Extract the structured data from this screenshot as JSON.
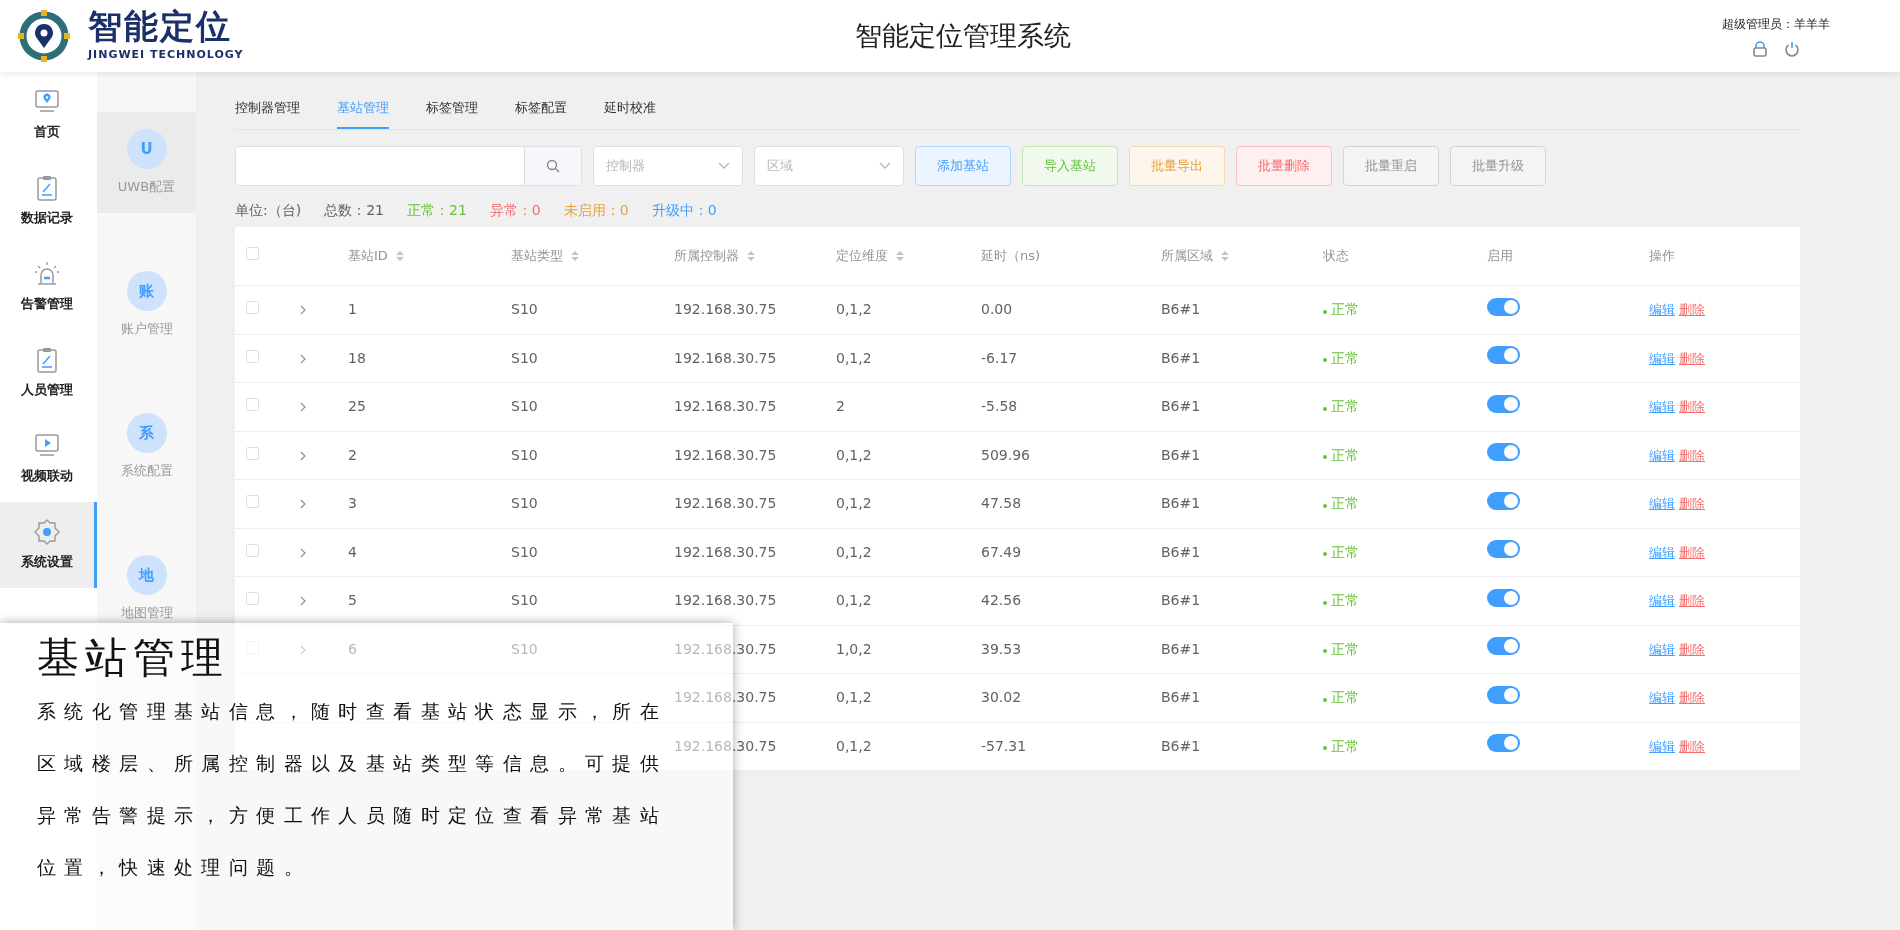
{
  "header": {
    "logo_title": "智能定位",
    "logo_subtitle": "JINGWEI TECHNOLOGY",
    "title": "智能定位管理系统",
    "user": "超级管理员：羊羊羊"
  },
  "sidebar": {
    "items": [
      {
        "label": "首页",
        "selected": false
      },
      {
        "label": "数据记录",
        "selected": false
      },
      {
        "label": "告警管理",
        "selected": false
      },
      {
        "label": "人员管理",
        "selected": false
      },
      {
        "label": "视频联动",
        "selected": false
      },
      {
        "label": "系统设置",
        "selected": true
      }
    ]
  },
  "subnav": {
    "items": [
      {
        "initial": "U",
        "label": "UWB配置",
        "selected": true
      },
      {
        "initial": "账",
        "label": "账户管理",
        "selected": false
      },
      {
        "initial": "系",
        "label": "系统配置",
        "selected": false
      },
      {
        "initial": "地",
        "label": "地图管理",
        "selected": false
      }
    ]
  },
  "tabs": [
    {
      "label": "控制器管理",
      "selected": false
    },
    {
      "label": "基站管理",
      "selected": true
    },
    {
      "label": "标签管理",
      "selected": false
    },
    {
      "label": "标签配置",
      "selected": false
    },
    {
      "label": "延时校准",
      "selected": false
    }
  ],
  "filters": {
    "selects": [
      {
        "placeholder": "控制器"
      },
      {
        "placeholder": "区域"
      }
    ]
  },
  "buttons": [
    {
      "label": "添加基站",
      "kind": "primary"
    },
    {
      "label": "导入基站",
      "kind": "success"
    },
    {
      "label": "批量导出",
      "kind": "warning"
    },
    {
      "label": "批量删除",
      "kind": "danger"
    },
    {
      "label": "批量重启",
      "kind": "default"
    },
    {
      "label": "批量升级",
      "kind": "default"
    }
  ],
  "stats": [
    {
      "text": "单位:（台)",
      "color": "#606266"
    },
    {
      "text": "总数：21",
      "color": "#606266"
    },
    {
      "text": "正常：21",
      "color": "#67c23a"
    },
    {
      "text": "异常：0",
      "color": "#f56c6c"
    },
    {
      "text": "未启用：0",
      "color": "#e6a23c"
    },
    {
      "text": "升级中：0",
      "color": "#409eff"
    }
  ],
  "table": {
    "all_checked": false,
    "columns": [
      {
        "label": "基站ID",
        "sortable": true
      },
      {
        "label": "基站类型",
        "sortable": true
      },
      {
        "label": "所属控制器",
        "sortable": true
      },
      {
        "label": "定位维度",
        "sortable": true
      },
      {
        "label": "延时（ns)",
        "sortable": false
      },
      {
        "label": "所属区域",
        "sortable": true
      },
      {
        "label": "状态",
        "sortable": false
      },
      {
        "label": "启用",
        "sortable": false
      },
      {
        "label": "操作",
        "sortable": false
      }
    ],
    "rows": [
      {
        "checked": false,
        "id": "1",
        "type": "S10",
        "controller": "192.168.30.75",
        "dimension": "0,1,2",
        "delay": "0.00",
        "area": "B6#1",
        "status": "正常",
        "enabled": true,
        "actions": [
          "编辑",
          "删除"
        ]
      },
      {
        "checked": false,
        "id": "18",
        "type": "S10",
        "controller": "192.168.30.75",
        "dimension": "0,1,2",
        "delay": "-6.17",
        "area": "B6#1",
        "status": "正常",
        "enabled": true,
        "actions": [
          "编辑",
          "删除"
        ]
      },
      {
        "checked": false,
        "id": "25",
        "type": "S10",
        "controller": "192.168.30.75",
        "dimension": "2",
        "delay": "-5.58",
        "area": "B6#1",
        "status": "正常",
        "enabled": true,
        "actions": [
          "编辑",
          "删除"
        ]
      },
      {
        "checked": false,
        "id": "2",
        "type": "S10",
        "controller": "192.168.30.75",
        "dimension": "0,1,2",
        "delay": "509.96",
        "area": "B6#1",
        "status": "正常",
        "enabled": true,
        "actions": [
          "编辑",
          "删除"
        ]
      },
      {
        "checked": false,
        "id": "3",
        "type": "S10",
        "controller": "192.168.30.75",
        "dimension": "0,1,2",
        "delay": "47.58",
        "area": "B6#1",
        "status": "正常",
        "enabled": true,
        "actions": [
          "编辑",
          "删除"
        ]
      },
      {
        "checked": false,
        "id": "4",
        "type": "S10",
        "controller": "192.168.30.75",
        "dimension": "0,1,2",
        "delay": "67.49",
        "area": "B6#1",
        "status": "正常",
        "enabled": true,
        "actions": [
          "编辑",
          "删除"
        ]
      },
      {
        "checked": false,
        "id": "5",
        "type": "S10",
        "controller": "192.168.30.75",
        "dimension": "0,1,2",
        "delay": "42.56",
        "area": "B6#1",
        "status": "正常",
        "enabled": true,
        "actions": [
          "编辑",
          "删除"
        ]
      },
      {
        "checked": false,
        "id": "6",
        "type": "S10",
        "controller": "192.168.30.75",
        "dimension": "1,0,2",
        "delay": "39.53",
        "area": "B6#1",
        "status": "正常",
        "enabled": true,
        "actions": [
          "编辑",
          "删除"
        ]
      },
      {
        "controller": "192.168.30.75",
        "dimension": "0,1,2",
        "delay": "30.02",
        "area": "B6#1",
        "status": "正常",
        "enabled": true,
        "actions": [
          "编辑",
          "删除"
        ]
      },
      {
        "controller": "192.168.30.75",
        "dimension": "0,1,2",
        "delay": "-57.31",
        "area": "B6#1",
        "status": "正常",
        "enabled": true,
        "actions": [
          "编辑",
          "删除"
        ]
      }
    ]
  },
  "overlay": {
    "title": "基站管理",
    "text": "系统化管理基站信息，随时查看基站状态显示，所在区域楼层、所属控制器以及基站类型等信息。可提供异常告警提示，方便工作人员随时定位查看异常基站位置，快速处理问题。"
  }
}
